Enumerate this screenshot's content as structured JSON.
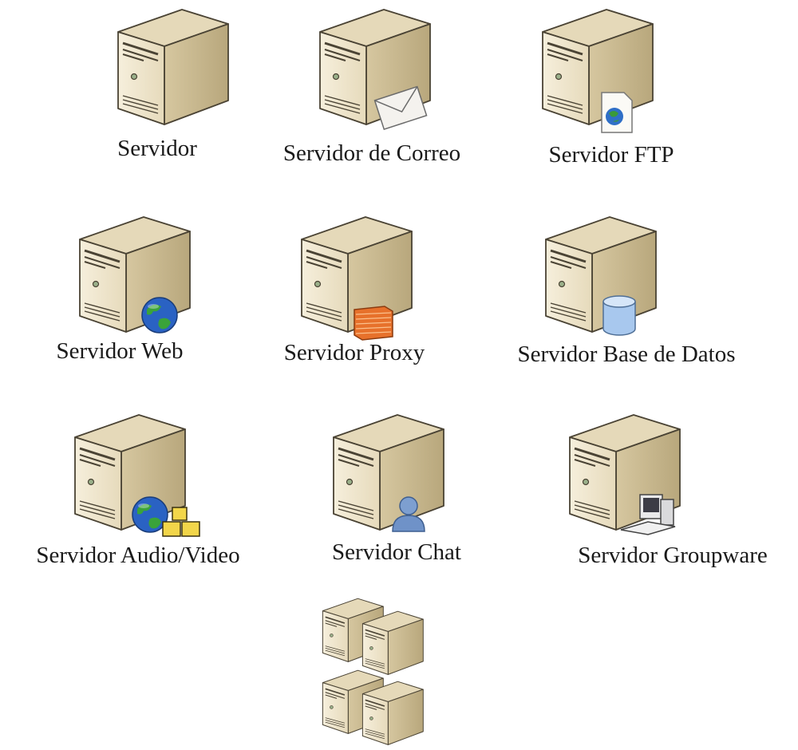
{
  "servers": [
    {
      "label": "Servidor",
      "badge": "none-icon"
    },
    {
      "label": "Servidor de Correo",
      "badge": "envelope-icon"
    },
    {
      "label": "Servidor FTP",
      "badge": "globe-document-icon"
    },
    {
      "label": "Servidor Web",
      "badge": "globe-icon"
    },
    {
      "label": "Servidor Proxy",
      "badge": "firewall-icon"
    },
    {
      "label": "Servidor Base de Datos",
      "badge": "database-icon"
    },
    {
      "label": "Servidor Audio/Video",
      "badge": "globe-media-icon"
    },
    {
      "label": "Servidor Chat",
      "badge": "user-icon"
    },
    {
      "label": "Servidor Groupware",
      "badge": "workstation-icon"
    }
  ],
  "cluster": {
    "badge": "server-cluster-icon"
  },
  "colors": {
    "tower_front": "#efe6cf",
    "tower_side": "#c9b98f",
    "tower_top": "#e2d6b6",
    "outline": "#4a4334",
    "label_text": "#1a1a1a"
  }
}
